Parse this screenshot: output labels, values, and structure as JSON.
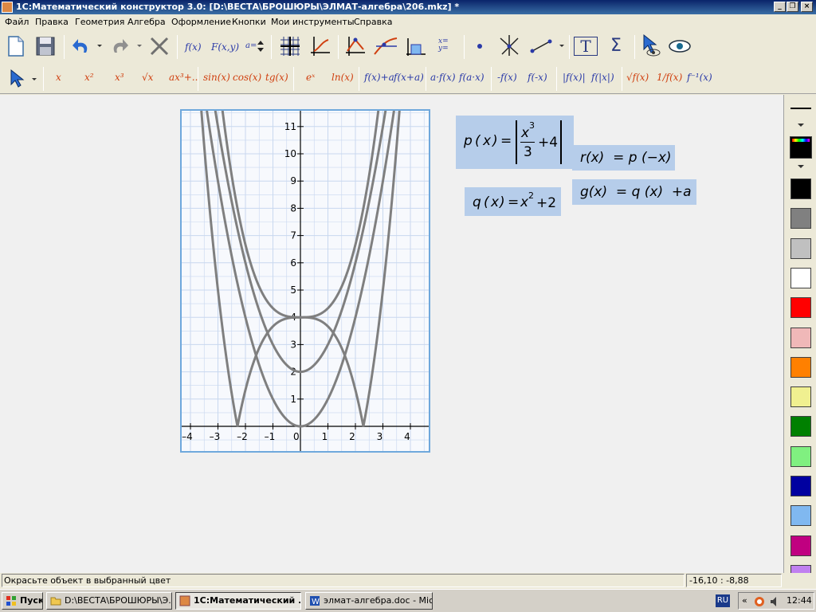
{
  "window": {
    "title": "1С:Математический конструктор 3.0: [D:\\ВЕСТА\\БРОШЮРЫ\\ЭЛМАТ-алгебра\\206.mkz] *"
  },
  "menu": [
    "Файл",
    "Правка",
    "Геометрия",
    "Алгебра",
    "Оформление",
    "Кнопки",
    "Мои инструменты",
    "Справка"
  ],
  "toolbar1": {
    "fx": "f(x)",
    "fxy": "F(x,y)",
    "param": "a=",
    "xy_eq": "x=\ny=",
    "text_tool": "T",
    "sigma": "Σ"
  },
  "toolbar2": {
    "items": [
      "x",
      "x²",
      "x³",
      "√x",
      "ax³+..",
      "sin(x)",
      "cos(x)",
      "tg(x)",
      "eˣ",
      "ln(x)",
      "f(x)+a",
      "f(x+a)",
      "a·f(x)",
      "f(a·x)",
      "-f(x)",
      "f(-x)",
      "|f(x)|",
      "f(|x|)",
      "√f(x)",
      "1/f(x)",
      "f⁻¹(x)"
    ]
  },
  "plot": {
    "x_ticks": [
      "–4",
      "–3",
      "–2",
      "–1",
      "0",
      "1",
      "2",
      "3",
      "4"
    ],
    "y_ticks": [
      "1",
      "2",
      "3",
      "4",
      "5",
      "6",
      "7",
      "8",
      "9",
      "10",
      "11"
    ]
  },
  "formulas": {
    "p": {
      "name": "p",
      "var": "x",
      "num": "x",
      "exp": "3",
      "den": "3",
      "rest": "+4"
    },
    "q": {
      "name": "q",
      "var": "x",
      "base": "x",
      "exp": "2",
      "rest": "+2"
    },
    "r": {
      "text": "r(x)  = p (−x)"
    },
    "g": {
      "text": "g(x)  = q (x)  +a"
    }
  },
  "chart_data": {
    "type": "line",
    "xlim": [
      -4,
      4
    ],
    "ylim": [
      0,
      11
    ],
    "grid": true,
    "series": [
      {
        "expr": "|x^3/3+4|"
      },
      {
        "expr": "x^2+2"
      },
      {
        "expr": "|-x^3/3+4|"
      },
      {
        "expr": "x^2+2+a"
      }
    ]
  },
  "palette": {
    "colors": [
      "#000000",
      "#808080",
      "#c0c0c0",
      "#ffffff",
      "#ff0000",
      "#f0b8b8",
      "#ff8000",
      "#f0f090",
      "#008000",
      "#80f080",
      "#0000a0",
      "#80b8f0",
      "#c00080",
      "#c080f0"
    ]
  },
  "status": {
    "text": "Окрасьте объект в выбранный цвет",
    "coords": "-16,10 : -8,88"
  },
  "taskbar": {
    "start": "Пуск",
    "tasks": [
      "D:\\ВЕСТА\\БРОШЮРЫ\\Э...",
      "1С:Математический ...",
      "элмат-алгебра.doc - Mic..."
    ],
    "lang": "RU",
    "clock": "12:44"
  }
}
